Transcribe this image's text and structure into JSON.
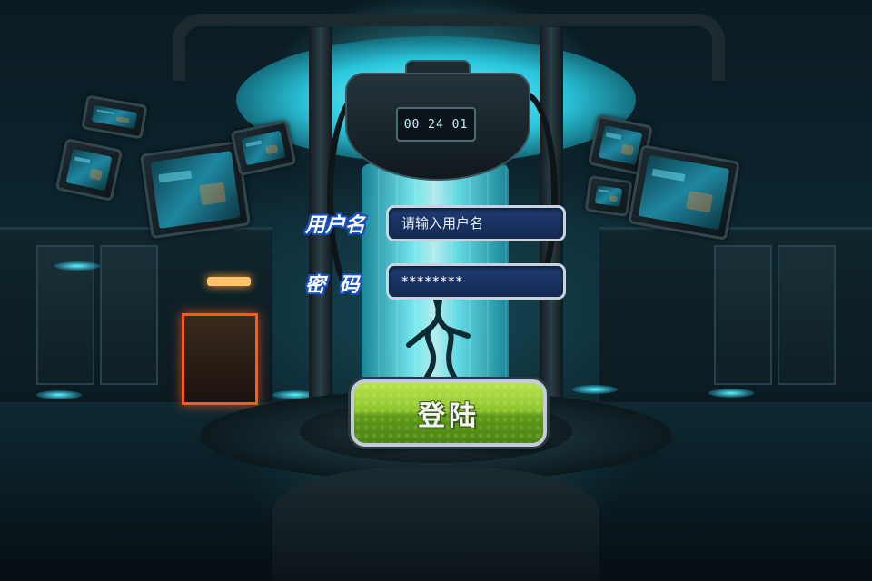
{
  "clock": {
    "time": "00 24 01"
  },
  "login": {
    "username_label": "用户名",
    "username_placeholder": "请输入用户名",
    "password_label": "密  码",
    "password_value": "********",
    "submit_label": "登陆"
  },
  "colors": {
    "label_outline": "#1a4fbf",
    "field_bg": "#1c3566",
    "field_border": "#c7d3df",
    "button_green": "#8fc52c",
    "tank_cyan": "#7ff8ff"
  }
}
